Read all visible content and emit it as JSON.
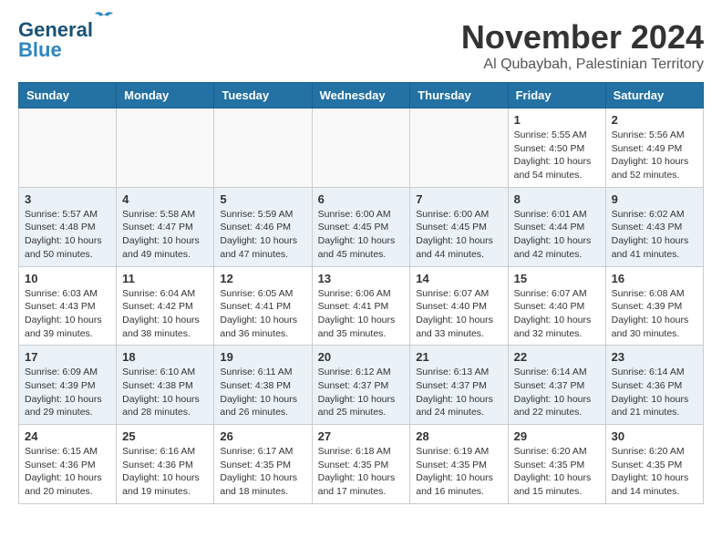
{
  "header": {
    "logo_line1": "General",
    "logo_line2": "Blue",
    "month": "November 2024",
    "location": "Al Qubaybah, Palestinian Territory"
  },
  "weekdays": [
    "Sunday",
    "Monday",
    "Tuesday",
    "Wednesday",
    "Thursday",
    "Friday",
    "Saturday"
  ],
  "weeks": [
    [
      {
        "day": "",
        "info": ""
      },
      {
        "day": "",
        "info": ""
      },
      {
        "day": "",
        "info": ""
      },
      {
        "day": "",
        "info": ""
      },
      {
        "day": "",
        "info": ""
      },
      {
        "day": "1",
        "info": "Sunrise: 5:55 AM\nSunset: 4:50 PM\nDaylight: 10 hours\nand 54 minutes."
      },
      {
        "day": "2",
        "info": "Sunrise: 5:56 AM\nSunset: 4:49 PM\nDaylight: 10 hours\nand 52 minutes."
      }
    ],
    [
      {
        "day": "3",
        "info": "Sunrise: 5:57 AM\nSunset: 4:48 PM\nDaylight: 10 hours\nand 50 minutes."
      },
      {
        "day": "4",
        "info": "Sunrise: 5:58 AM\nSunset: 4:47 PM\nDaylight: 10 hours\nand 49 minutes."
      },
      {
        "day": "5",
        "info": "Sunrise: 5:59 AM\nSunset: 4:46 PM\nDaylight: 10 hours\nand 47 minutes."
      },
      {
        "day": "6",
        "info": "Sunrise: 6:00 AM\nSunset: 4:45 PM\nDaylight: 10 hours\nand 45 minutes."
      },
      {
        "day": "7",
        "info": "Sunrise: 6:00 AM\nSunset: 4:45 PM\nDaylight: 10 hours\nand 44 minutes."
      },
      {
        "day": "8",
        "info": "Sunrise: 6:01 AM\nSunset: 4:44 PM\nDaylight: 10 hours\nand 42 minutes."
      },
      {
        "day": "9",
        "info": "Sunrise: 6:02 AM\nSunset: 4:43 PM\nDaylight: 10 hours\nand 41 minutes."
      }
    ],
    [
      {
        "day": "10",
        "info": "Sunrise: 6:03 AM\nSunset: 4:43 PM\nDaylight: 10 hours\nand 39 minutes."
      },
      {
        "day": "11",
        "info": "Sunrise: 6:04 AM\nSunset: 4:42 PM\nDaylight: 10 hours\nand 38 minutes."
      },
      {
        "day": "12",
        "info": "Sunrise: 6:05 AM\nSunset: 4:41 PM\nDaylight: 10 hours\nand 36 minutes."
      },
      {
        "day": "13",
        "info": "Sunrise: 6:06 AM\nSunset: 4:41 PM\nDaylight: 10 hours\nand 35 minutes."
      },
      {
        "day": "14",
        "info": "Sunrise: 6:07 AM\nSunset: 4:40 PM\nDaylight: 10 hours\nand 33 minutes."
      },
      {
        "day": "15",
        "info": "Sunrise: 6:07 AM\nSunset: 4:40 PM\nDaylight: 10 hours\nand 32 minutes."
      },
      {
        "day": "16",
        "info": "Sunrise: 6:08 AM\nSunset: 4:39 PM\nDaylight: 10 hours\nand 30 minutes."
      }
    ],
    [
      {
        "day": "17",
        "info": "Sunrise: 6:09 AM\nSunset: 4:39 PM\nDaylight: 10 hours\nand 29 minutes."
      },
      {
        "day": "18",
        "info": "Sunrise: 6:10 AM\nSunset: 4:38 PM\nDaylight: 10 hours\nand 28 minutes."
      },
      {
        "day": "19",
        "info": "Sunrise: 6:11 AM\nSunset: 4:38 PM\nDaylight: 10 hours\nand 26 minutes."
      },
      {
        "day": "20",
        "info": "Sunrise: 6:12 AM\nSunset: 4:37 PM\nDaylight: 10 hours\nand 25 minutes."
      },
      {
        "day": "21",
        "info": "Sunrise: 6:13 AM\nSunset: 4:37 PM\nDaylight: 10 hours\nand 24 minutes."
      },
      {
        "day": "22",
        "info": "Sunrise: 6:14 AM\nSunset: 4:37 PM\nDaylight: 10 hours\nand 22 minutes."
      },
      {
        "day": "23",
        "info": "Sunrise: 6:14 AM\nSunset: 4:36 PM\nDaylight: 10 hours\nand 21 minutes."
      }
    ],
    [
      {
        "day": "24",
        "info": "Sunrise: 6:15 AM\nSunset: 4:36 PM\nDaylight: 10 hours\nand 20 minutes."
      },
      {
        "day": "25",
        "info": "Sunrise: 6:16 AM\nSunset: 4:36 PM\nDaylight: 10 hours\nand 19 minutes."
      },
      {
        "day": "26",
        "info": "Sunrise: 6:17 AM\nSunset: 4:35 PM\nDaylight: 10 hours\nand 18 minutes."
      },
      {
        "day": "27",
        "info": "Sunrise: 6:18 AM\nSunset: 4:35 PM\nDaylight: 10 hours\nand 17 minutes."
      },
      {
        "day": "28",
        "info": "Sunrise: 6:19 AM\nSunset: 4:35 PM\nDaylight: 10 hours\nand 16 minutes."
      },
      {
        "day": "29",
        "info": "Sunrise: 6:20 AM\nSunset: 4:35 PM\nDaylight: 10 hours\nand 15 minutes."
      },
      {
        "day": "30",
        "info": "Sunrise: 6:20 AM\nSunset: 4:35 PM\nDaylight: 10 hours\nand 14 minutes."
      }
    ]
  ]
}
